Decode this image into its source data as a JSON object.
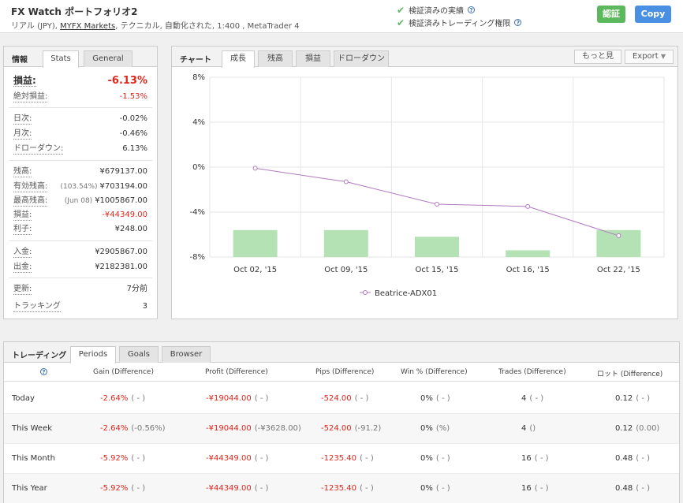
{
  "account": {
    "title": "FX Watch ポートフォリオ2",
    "sub_prefix": "リアル (JPY), ",
    "broker": "MYFX Markets",
    "sub_suffix": ", テクニカル, 自動化された, 1:400 , MetaTrader 4",
    "verified_track": "検証済みの実績",
    "verified_privileges": "検証済みトレーディング権限",
    "btn_primary": "認証",
    "btn_copy": "Copy"
  },
  "info": {
    "label": "情報",
    "tabs": [
      "Stats",
      "General"
    ],
    "rows": [
      {
        "label": "損益:",
        "value": "-6.13%",
        "red": true,
        "big": true
      },
      {
        "label": "絶対損益:",
        "value": "-1.53%",
        "red": true
      },
      {
        "label": "日次:",
        "value": "-0.02%"
      },
      {
        "label": "月次:",
        "value": "-0.46%"
      },
      {
        "label": "ドローダウン:",
        "value": "6.13%"
      },
      {
        "label": "残高:",
        "value": "¥679137.00"
      },
      {
        "label": "有効残高:",
        "paren": "(103.54%)",
        "value": "¥703194.00"
      },
      {
        "label": "最高残高:",
        "paren": "(Jun 08)",
        "value": "¥1005867.00"
      },
      {
        "label": "損益:",
        "value": "-¥44349.00",
        "red": true
      },
      {
        "label": "利子:",
        "value": "¥248.00"
      },
      {
        "label": "入金:",
        "value": "¥2905867.00"
      },
      {
        "label": "出金:",
        "value": "¥2182381.00"
      },
      {
        "label": "更新:",
        "value": "7分前"
      },
      {
        "label": "トラッキング",
        "value": "3"
      }
    ]
  },
  "chart_panel": {
    "label": "チャート",
    "tabs": [
      "成長",
      "残高",
      "損益",
      "ドローダウン"
    ],
    "more_label": "もっと見",
    "export_label": "Export"
  },
  "chart_data": {
    "type": "bar",
    "categories": [
      "Oct 02, '15",
      "Oct 09, '15",
      "Oct 15, '15",
      "Oct 16, '15",
      "Oct 22, '15"
    ],
    "ylim": [
      -8,
      8
    ],
    "yticks": [
      "8%",
      "4%",
      "0%",
      "-4%",
      "-8%"
    ],
    "ytick_values": [
      8,
      4,
      0,
      -4,
      -8
    ],
    "bars": [
      -5.6,
      -5.6,
      -6.2,
      -7.4,
      -5.6
    ],
    "series": [
      {
        "name": "Beatrice-ADX01",
        "values": [
          -0.1,
          -1.3,
          -3.3,
          -3.5,
          -6.1
        ],
        "color": "#b07ac0"
      }
    ],
    "bar_color": "#b5e2b5",
    "grid": true,
    "legend": "bottom"
  },
  "trading": {
    "label": "トレーディング",
    "tabs": [
      "Periods",
      "Goals",
      "Browser"
    ],
    "headers": [
      "Gain (Difference)",
      "Profit (Difference)",
      "Pips (Difference)",
      "Win % (Difference)",
      "Trades (Difference)",
      "ロット (Difference)"
    ],
    "rows": [
      {
        "period": "Today",
        "gain": "-2.64%",
        "gain_d": "( - )",
        "profit": "-¥19044.00",
        "profit_d": "( - )",
        "pips": "-524.00",
        "pips_d": "( - )",
        "win": "0%",
        "win_d": "( - )",
        "trades": "4",
        "trades_d": "( - )",
        "lots": "0.12",
        "lots_d": "( - )"
      },
      {
        "period": "This Week",
        "gain": "-2.64%",
        "gain_d": "(-0.56%)",
        "profit": "-¥19044.00",
        "profit_d": "(-¥3628.00)",
        "pips": "-524.00",
        "pips_d": "(-91.2)",
        "win": "0%",
        "win_d": "(%)",
        "trades": "4",
        "trades_d": "()",
        "lots": "0.12",
        "lots_d": "(0.00)"
      },
      {
        "period": "This Month",
        "gain": "-5.92%",
        "gain_d": "( - )",
        "profit": "-¥44349.00",
        "profit_d": "( - )",
        "pips": "-1235.40",
        "pips_d": "( - )",
        "win": "0%",
        "win_d": "( - )",
        "trades": "16",
        "trades_d": "( - )",
        "lots": "0.48",
        "lots_d": "( - )"
      },
      {
        "period": "This Year",
        "gain": "-5.92%",
        "gain_d": "( - )",
        "profit": "-¥44349.00",
        "profit_d": "( - )",
        "pips": "-1235.40",
        "pips_d": "( - )",
        "win": "0%",
        "win_d": "( - )",
        "trades": "16",
        "trades_d": "( - )",
        "lots": "0.48",
        "lots_d": "( - )"
      }
    ]
  }
}
